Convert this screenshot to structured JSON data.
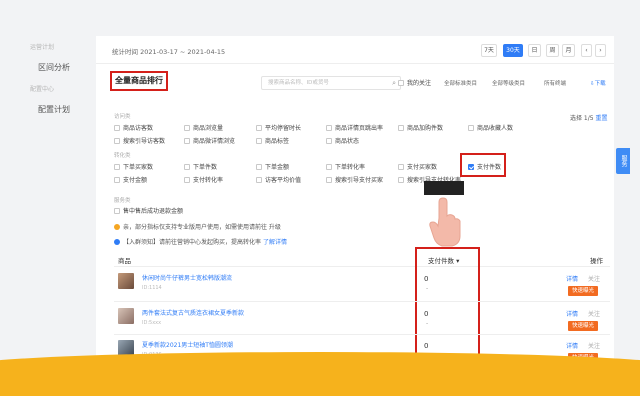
{
  "sidebar": {
    "faded_group": "运营计划",
    "link1": "区间分析",
    "group2": "配置中心",
    "link2": "配置计划"
  },
  "date_bar": {
    "stat_text": "统计时间 2021-03-17 ~ 2021-04-15",
    "buttons": [
      "7天",
      "30天",
      "日",
      "周",
      "月"
    ],
    "active": "30天",
    "prev": "‹",
    "next": "›"
  },
  "ranking": {
    "title": "全量商品排行",
    "search_placeholder": "搜索商品名称、ID或货号",
    "checkbox_label": "我的关注",
    "cat1": "全部标准类目",
    "cat2": "全部等级类目",
    "cat3": "所有终端",
    "download": "下载"
  },
  "sections": {
    "flow_label": "访问类",
    "conversion_label": "转化类",
    "service_label": "服务类"
  },
  "flow_items": [
    "商品访客数",
    "商品浏览量",
    "平均停留时长",
    "商品详情页跳出率",
    "商品加购件数",
    "商品收藏人数",
    "搜索引导访客数",
    "商品微详情浏览",
    "商品标签",
    "商品状态"
  ],
  "conversion_items": [
    "下单买家数",
    "下单件数",
    "下单金额",
    "下单转化率",
    "支付买家数",
    "支付件数",
    "支付金额",
    "支付转化率",
    "访客平均价值",
    "搜索引导支付买家",
    "搜索引导支付转化率"
  ],
  "service_items": [
    "售中售后成功退款金额"
  ],
  "selection": {
    "text": "选择 1/5",
    "reset": "重置"
  },
  "tips": {
    "tip1": "亲，部分指标仅支持专业版用户使用，如需使用请前往 升级",
    "tip1_link": "升级",
    "tip2": "【入群须知】请前往营销中心发起购买，提高转化率",
    "tip2_link": "了解详情"
  },
  "table": {
    "col_product": "商品",
    "col_paid": "支付件数",
    "col_op": "操作",
    "rows": [
      {
        "name": "休闲时尚牛仔裤男士宽松韩版潮流",
        "id": "ID:1114",
        "paid": "0",
        "dash": "-",
        "detail": "详情",
        "follow": "关注",
        "badge": "快速曝光"
      },
      {
        "name": "两件套法式复古气质连衣裙女夏季新款",
        "id": "ID:5xxx",
        "paid": "0",
        "dash": "-",
        "detail": "详情",
        "follow": "关注",
        "badge": "快速曝光"
      },
      {
        "name": "夏季新款2021男士短袖T恤圆领潮",
        "id": "ID:0136",
        "paid": "0",
        "dash": "-",
        "detail": "详情",
        "follow": "关注",
        "badge": "快速曝光"
      }
    ]
  },
  "service_tab": "服务",
  "icons": {
    "search": "search-icon",
    "download": "download-icon",
    "sort": "sort-down-icon",
    "hand": "pointer-hand-icon"
  },
  "colors": {
    "accent": "#2f7cf6",
    "highlight": "#d4201a",
    "badge": "#f26b21",
    "footer": "#f6b21c"
  }
}
